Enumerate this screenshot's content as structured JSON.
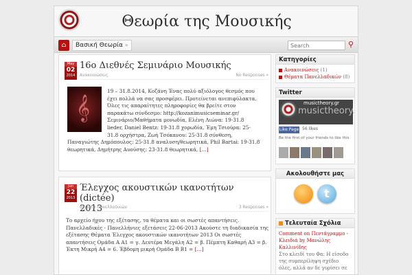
{
  "site": {
    "title": "Θεωρία της Μουσικής"
  },
  "nav": {
    "items": [
      "Βασική Θεωρία"
    ],
    "search_placeholder": "Search"
  },
  "posts": [
    {
      "month": "May",
      "day": "02",
      "year": "2014",
      "title": "16ο Διεθνές Σεμινάριο Μουσικής",
      "category": "Ανακοινώσεις",
      "comments": "No Responses »",
      "excerpt_lines": [
        "19 – 31.8.2014, Κοζάνη Ένας πολύ αξιόλογος θεσμός που",
        "έχει πολλά να σας προσφέρει. Προτείνεται ανεπιφύλακτα.",
        "Όλες τις απαραίτητες πληροφορίες θα βρείτε στον",
        "παρακάτω σύνδεσμο: http://kozanimusicseminar.gr/",
        "Σεμινάριο/Μαθήματα μονωδία, Ελένη Λιώνα: 19-31.8",
        "lieder, Daniel Bentz: 19-31.8 χορωδία, Έμη Τσιούρα: 25-",
        "31.8 ορχήστρα, Ζωή Τσόκανου: 25-31.8 σύνθεση,",
        "Παναγιώτης Δημόπουλος: 25-31.8 αναλυση/θεωρητικά, Phil Bartai: 19-31.8",
        "θεωρητικά, Δημήτρης Αυούσης: 23-31.8 θεωρητικά,"
      ],
      "more": "[…]"
    },
    {
      "month": "Jun",
      "day": "22",
      "year": "2013",
      "title_lines": [
        "Έλεγχος ακουστικών ικανοτήτων (dictée)",
        "2013"
      ],
      "category": "Θέματα Πανελλαδικών",
      "comments": "3 Responses »",
      "excerpt_lines": [
        "Το αρχείο ήχου της εξέτασης, τα θέματα και οι σωστές απαντήσεις.",
        "Πανελλαδικές - Πανελλήνιες εξετάσεις 22-06-2013 Ακούστε τη διαδικασία της",
        "εξέτασης Θέματα Έλεγχος ακουστικών ικανοτήτων 2013 Οι σωστές",
        "απαντήσεις Ομάδα Α Α1 = γ. Δευτέρα Μεγάλη Α2 = β. Πέμπτη Καθαρή Α3 = β.",
        "Έκτη Μικρή Α4 = 6. Έβδομη μικρή Ομάδα Β Β1 ="
      ],
      "more": "[…]"
    }
  ],
  "sidebar": {
    "categories_title": "Κατηγορίες",
    "categories": [
      {
        "label": "Ανακοινώσεις",
        "count": "(1)"
      },
      {
        "label": "Θέματα Πανελλαδικών",
        "count": "(8)"
      }
    ],
    "twitter_title": "Twitter",
    "fb": {
      "name": "musictheory.gr",
      "big": "musictheory.gr",
      "like": "Like Page",
      "count": "56 likes",
      "first": "Be the first of your friends to like this"
    },
    "follow_title": "Ακολουθήστε μας",
    "comments_title": "Τελευταία Σχόλια",
    "comment": {
      "link": "Comment on Πεντάγραμμο - Κλειδιά by Μανώλης Καλλινίδης",
      "text": "Στο κλειδί του Φα: Η είσοδο της συμπερίληψη σχέδιο όλες, αλλά αν δε γυρίσει σε ..."
    }
  }
}
